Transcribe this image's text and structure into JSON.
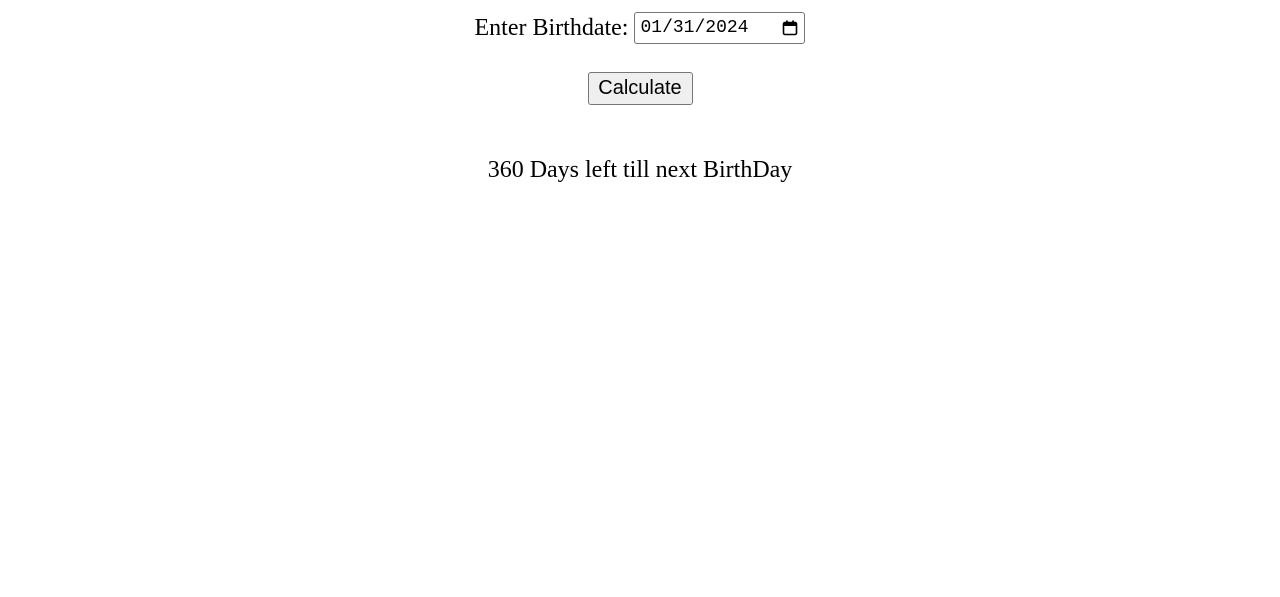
{
  "form": {
    "birthdate_label": "Enter Birthdate:",
    "birthdate_value": "01/31/2024",
    "calendar_icon": "calendar-icon",
    "calculate_label": "Calculate"
  },
  "result": {
    "message": "360 Days left till next BirthDay"
  }
}
